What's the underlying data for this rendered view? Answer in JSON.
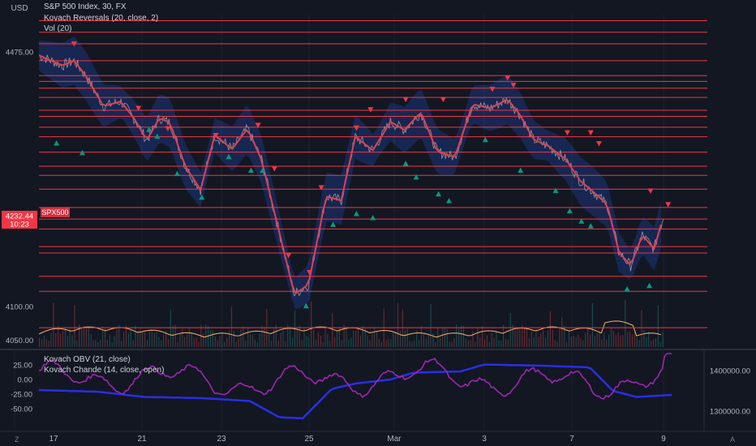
{
  "header": {
    "currency": "USD",
    "symbol_title": "S&P 500 Index, 30, FX",
    "study_1": "Kovach Reversals (20, close, 2)",
    "study_2": "Vol (20)"
  },
  "lower_pane": {
    "study_1": "Kovach OBV (21, close)",
    "study_2": "Kovach Chande (14, close, open)",
    "left_ticks": [
      "25.00",
      "0.00",
      "-25.00",
      "-50.00"
    ],
    "right_ticks": [
      "1400000.00",
      "1300000.00"
    ]
  },
  "price_axis": {
    "levels": [
      "4521.00",
      "4504.00",
      "4487.00",
      "4462.00",
      "4440.04",
      "4431.54",
      "4421.61",
      "4408.00",
      "4389.00",
      "4380.00",
      "4364.00",
      "4350.00",
      "4327.35",
      "4306.58",
      "4293.07",
      "4272.71",
      "4245.65",
      "4228.70",
      "4214.00",
      "4188.02",
      "4178.59",
      "4144.27",
      "4122.23",
      "4068.59"
    ],
    "plain_ticks": [
      "4475.00",
      "4100.00",
      "4050.00"
    ],
    "current_price": "4232.44",
    "countdown": "10:23",
    "symbol_badge": "SPX500"
  },
  "time_axis": {
    "labels": [
      "17",
      "21",
      "23",
      "25",
      "Mar",
      "3",
      "7",
      "9"
    ]
  },
  "footer": {
    "left_icon": "Z",
    "right_icon": "A"
  },
  "colors": {
    "background": "#131722",
    "level_line": "#f23645",
    "level_badge": "#ff1e2d",
    "band_fill": "#2962ff",
    "ma_line": "#e04050",
    "volume_ma": "#f5b06b",
    "obv_line": "#2a2ee8",
    "chande_line": "#9c27b0",
    "buy_marker": "#089981",
    "sell_marker": "#f23645"
  },
  "chart_data": {
    "type": "line",
    "price_pane": {
      "y_range": [
        4040,
        4530
      ],
      "horizontal_levels": [
        4521.0,
        4504.0,
        4487.0,
        4462.0,
        4440.04,
        4431.54,
        4421.61,
        4408.0,
        4389.0,
        4380.0,
        4364.0,
        4350.0,
        4327.35,
        4306.58,
        4293.07,
        4272.71,
        4245.65,
        4228.7,
        4214.0,
        4188.02,
        4178.59,
        4144.27,
        4122.23,
        4068.59
      ],
      "price_keypoints": [
        {
          "t": 0,
          "p": 4470
        },
        {
          "t": 20,
          "p": 4455
        },
        {
          "t": 30,
          "p": 4462
        },
        {
          "t": 40,
          "p": 4440
        },
        {
          "t": 55,
          "p": 4395
        },
        {
          "t": 70,
          "p": 4402
        },
        {
          "t": 82,
          "p": 4375
        },
        {
          "t": 92,
          "p": 4345
        },
        {
          "t": 103,
          "p": 4378
        },
        {
          "t": 112,
          "p": 4370
        },
        {
          "t": 125,
          "p": 4306
        },
        {
          "t": 138,
          "p": 4272
        },
        {
          "t": 150,
          "p": 4352
        },
        {
          "t": 165,
          "p": 4332
        },
        {
          "t": 178,
          "p": 4362
        },
        {
          "t": 190,
          "p": 4316
        },
        {
          "t": 205,
          "p": 4210
        },
        {
          "t": 218,
          "p": 4118
        },
        {
          "t": 230,
          "p": 4132
        },
        {
          "t": 245,
          "p": 4262
        },
        {
          "t": 258,
          "p": 4256
        },
        {
          "t": 270,
          "p": 4350
        },
        {
          "t": 285,
          "p": 4330
        },
        {
          "t": 300,
          "p": 4372
        },
        {
          "t": 312,
          "p": 4360
        },
        {
          "t": 326,
          "p": 4386
        },
        {
          "t": 340,
          "p": 4328
        },
        {
          "t": 355,
          "p": 4320
        },
        {
          "t": 370,
          "p": 4398
        },
        {
          "t": 385,
          "p": 4392
        },
        {
          "t": 400,
          "p": 4405
        },
        {
          "t": 410,
          "p": 4384
        },
        {
          "t": 422,
          "p": 4346
        },
        {
          "t": 435,
          "p": 4336
        },
        {
          "t": 450,
          "p": 4316
        },
        {
          "t": 462,
          "p": 4285
        },
        {
          "t": 475,
          "p": 4266
        },
        {
          "t": 485,
          "p": 4250
        },
        {
          "t": 495,
          "p": 4180
        },
        {
          "t": 505,
          "p": 4160
        },
        {
          "t": 515,
          "p": 4205
        },
        {
          "t": 525,
          "p": 4185
        },
        {
          "t": 533,
          "p": 4232
        }
      ],
      "buy_signals": [
        {
          "t": 15,
          "p": 4340
        },
        {
          "t": 37,
          "p": 4326
        },
        {
          "t": 94,
          "p": 4360
        },
        {
          "t": 101,
          "p": 4350
        },
        {
          "t": 118,
          "p": 4295
        },
        {
          "t": 139,
          "p": 4260
        },
        {
          "t": 162,
          "p": 4320
        },
        {
          "t": 181,
          "p": 4300
        },
        {
          "t": 191,
          "p": 4300
        },
        {
          "t": 228,
          "p": 4100
        },
        {
          "t": 251,
          "p": 4220
        },
        {
          "t": 271,
          "p": 4236
        },
        {
          "t": 285,
          "p": 4230
        },
        {
          "t": 313,
          "p": 4310
        },
        {
          "t": 322,
          "p": 4290
        },
        {
          "t": 341,
          "p": 4265
        },
        {
          "t": 350,
          "p": 4255
        },
        {
          "t": 381,
          "p": 4345
        },
        {
          "t": 411,
          "p": 4300
        },
        {
          "t": 441,
          "p": 4270
        },
        {
          "t": 453,
          "p": 4240
        },
        {
          "t": 463,
          "p": 4225
        },
        {
          "t": 471,
          "p": 4218
        },
        {
          "t": 502,
          "p": 4125
        },
        {
          "t": 521,
          "p": 4130
        }
      ],
      "sell_signals": [
        {
          "t": 30,
          "p": 4487
        },
        {
          "t": 85,
          "p": 4392
        },
        {
          "t": 110,
          "p": 4362
        },
        {
          "t": 151,
          "p": 4352
        },
        {
          "t": 187,
          "p": 4367
        },
        {
          "t": 201,
          "p": 4303
        },
        {
          "t": 213,
          "p": 4175
        },
        {
          "t": 231,
          "p": 4150
        },
        {
          "t": 241,
          "p": 4275
        },
        {
          "t": 271,
          "p": 4363
        },
        {
          "t": 283,
          "p": 4390
        },
        {
          "t": 313,
          "p": 4405
        },
        {
          "t": 345,
          "p": 4405
        },
        {
          "t": 387,
          "p": 4420
        },
        {
          "t": 400,
          "p": 4437
        },
        {
          "t": 405,
          "p": 4426
        },
        {
          "t": 451,
          "p": 4356
        },
        {
          "t": 471,
          "p": 4356
        },
        {
          "t": 478,
          "p": 4340
        },
        {
          "t": 522,
          "p": 4270
        },
        {
          "t": 537,
          "p": 4250
        }
      ]
    },
    "obv_pane": {
      "y_range": [
        1250000,
        1450000
      ],
      "obv_keypoints": [
        {
          "t": 0,
          "v": 1352000
        },
        {
          "t": 50,
          "v": 1348000
        },
        {
          "t": 90,
          "v": 1335000
        },
        {
          "t": 140,
          "v": 1332000
        },
        {
          "t": 180,
          "v": 1325000
        },
        {
          "t": 205,
          "v": 1285000
        },
        {
          "t": 225,
          "v": 1282000
        },
        {
          "t": 250,
          "v": 1355000
        },
        {
          "t": 270,
          "v": 1368000
        },
        {
          "t": 300,
          "v": 1378000
        },
        {
          "t": 320,
          "v": 1395000
        },
        {
          "t": 360,
          "v": 1398000
        },
        {
          "t": 380,
          "v": 1415000
        },
        {
          "t": 430,
          "v": 1412000
        },
        {
          "t": 470,
          "v": 1408000
        },
        {
          "t": 490,
          "v": 1350000
        },
        {
          "t": 510,
          "v": 1335000
        },
        {
          "t": 540,
          "v": 1340000
        }
      ]
    }
  }
}
